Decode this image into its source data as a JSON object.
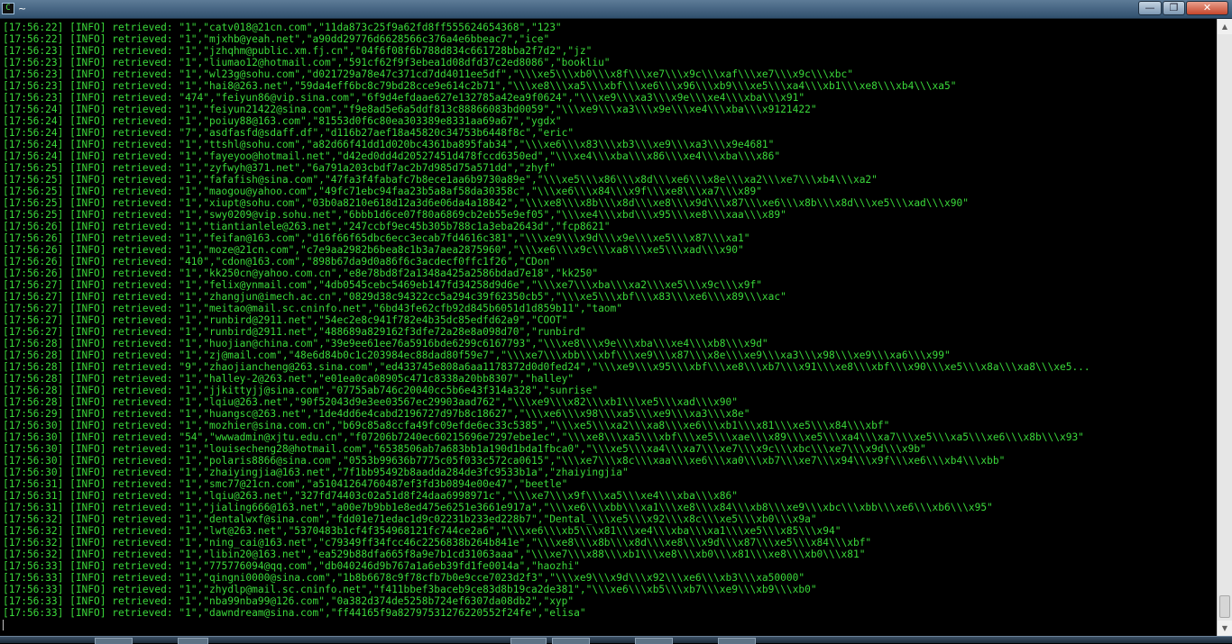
{
  "window": {
    "title": "~",
    "icon": "terminal-icon",
    "icon_glyph": "C",
    "minimize_glyph": "—",
    "maximize_glyph": "❐",
    "close_glyph": "✕"
  },
  "console": {
    "lines": [
      "[17:56:22] [INFO] retrieved: \"1\",\"catv018@21cn.com\",\"11da873c25f9a62fd8ff555624654368\",\"123\"",
      "[17:56:22] [INFO] retrieved: \"1\",\"mjxhb@yeah.net\",\"a90dd29776d6628566c376a4e6bbeac7\",\"ice\"",
      "[17:56:23] [INFO] retrieved: \"1\",\"jzhqhm@public.xm.fj.cn\",\"04f6f08f6b788d834c661728bba2f7d2\",\"jz\"",
      "[17:56:23] [INFO] retrieved: \"1\",\"liumao12@hotmail.com\",\"591cf62f9f3ebea1d08dfd37c2ed8086\",\"bookliu\"",
      "[17:56:23] [INFO] retrieved: \"1\",\"wl23g@sohu.com\",\"d021729a78e47c371cd7dd4011ee5df\",\"\\\\\\xe5\\\\\\xb0\\\\\\x8f\\\\\\xe7\\\\\\x9c\\\\\\xaf\\\\\\xe7\\\\\\x9c\\\\\\xbc\"",
      "[17:56:23] [INFO] retrieved: \"1\",\"hai8@263.net\",\"59da4eff6bc8c79bd28cce9e614c2b71\",\"\\\\\\xe8\\\\\\xa5\\\\\\xbf\\\\\\xe6\\\\\\x96\\\\\\xb9\\\\\\xe5\\\\\\xa4\\\\\\xb1\\\\\\xe8\\\\\\xb4\\\\\\xa5\"",
      "[17:56:23] [INFO] retrieved: \"474\",\"feiyun86@vip.sina.com\",\"6f9d4efdaae627e132785a42ea9f0624\",\"\\\\\\xe9\\\\\\xa3\\\\\\x9e\\\\\\xe4\\\\\\xba\\\\\\x91\"",
      "[17:56:24] [INFO] retrieved: \"1\",\"feiyun21422@sina.com\",\"f9e8ad5e6a5ddf813c88866083bd0059\",\"\\\\\\xe9\\\\\\xa3\\\\\\x9e\\\\\\xe4\\\\\\xba\\\\\\x9121422\"",
      "[17:56:24] [INFO] retrieved: \"1\",\"poiuy88@163.com\",\"81553d0f6c80ea303389e8331aa69a67\",\"ygdx\"",
      "[17:56:24] [INFO] retrieved: \"7\",\"asdfasfd@sdaff.df\",\"d116b27aef18a45820c34753b6448f8c\",\"eric\"",
      "[17:56:24] [INFO] retrieved: \"1\",\"ttshl@sohu.com\",\"a82d66f41dd1d020bc4361ba895fab34\",\"\\\\\\xe6\\\\\\x83\\\\\\xb3\\\\\\xe9\\\\\\xa3\\\\\\x9e4681\"",
      "[17:56:24] [INFO] retrieved: \"1\",\"fayeyoo@hotmail.net\",\"d42ed0dd4d20527451d478fccd6350ed\",\"\\\\\\xe4\\\\\\xba\\\\\\x86\\\\\\xe4\\\\\\xba\\\\\\x86\"",
      "[17:56:25] [INFO] retrieved: \"1\",\"zyfwyh@371.net\",\"6a791a203cbdf7ac2b7d985d75a571dd\",\"zhyf\"",
      "[17:56:25] [INFO] retrieved: \"1\",\"fafafish@sina.com\",\"47fa3f4fabafc7b8ece1aa6b9730a89e\",\"\\\\\\xe5\\\\\\x86\\\\\\x8d\\\\\\xe6\\\\\\x8e\\\\\\xa2\\\\\\xe7\\\\\\xb4\\\\\\xa2\"",
      "[17:56:25] [INFO] retrieved: \"1\",\"maogou@yahoo.com\",\"49fc71ebc94faa23b5a8af58da30358c\",\"\\\\\\xe6\\\\\\x84\\\\\\x9f\\\\\\xe8\\\\\\xa7\\\\\\x89\"",
      "[17:56:25] [INFO] retrieved: \"1\",\"xiupt@sohu.com\",\"03b0a8210e618d12a3d6e06da4a18842\",\"\\\\\\xe8\\\\\\x8b\\\\\\x8d\\\\\\xe8\\\\\\x9d\\\\\\x87\\\\\\xe6\\\\\\x8b\\\\\\x8d\\\\\\xe5\\\\\\xad\\\\\\x90\"",
      "[17:56:25] [INFO] retrieved: \"1\",\"swy0209@vip.sohu.net\",\"6bbb1d6ce07f80a6869cb2eb55e9ef05\",\"\\\\\\xe4\\\\\\xbd\\\\\\x95\\\\\\xe8\\\\\\xaa\\\\\\x89\"",
      "[17:56:26] [INFO] retrieved: \"1\",\"tiantianlele@263.net\",\"247ccbf9ec45b305b788c1a3eba2643d\",\"fcp8621\"",
      "[17:56:26] [INFO] retrieved: \"1\",\"feifan@163.com\",\"d16f66f65dbc6ecc3ecab7fd4616c381\",\"\\\\\\xe9\\\\\\x9d\\\\\\x9e\\\\\\xe5\\\\\\x87\\\\\\xa1\"",
      "[17:56:26] [INFO] retrieved: \"1\",\"moze@21cn.com\",\"c7e9aa2982b6bea8c1b3a7aea2875960\",\"\\\\\\xe6\\\\\\x9c\\\\\\xa8\\\\\\xe5\\\\\\xad\\\\\\x90\"",
      "[17:56:26] [INFO] retrieved: \"410\",\"cdon@163.com\",\"898b67da9d0a86f6c3acdecf0ffc1f26\",\"CDon\"",
      "[17:56:26] [INFO] retrieved: \"1\",\"kk250cn@yahoo.com.cn\",\"e8e78bd8f2a1348a425a2586bdad7e18\",\"kk250\"",
      "[17:56:27] [INFO] retrieved: \"1\",\"felix@ynmail.com\",\"4db0545cebc5469eb147fd34258d9d6e\",\"\\\\\\xe7\\\\\\xba\\\\\\xa2\\\\\\xe5\\\\\\x9c\\\\\\x9f\"",
      "[17:56:27] [INFO] retrieved: \"1\",\"zhangjun@imech.ac.cn\",\"0829d38c94322cc5a294c39f62350cb5\",\"\\\\\\xe5\\\\\\xbf\\\\\\x83\\\\\\xe6\\\\\\x89\\\\\\xac\"",
      "[17:56:27] [INFO] retrieved: \"1\",\"meitao@mail.sc.cninfo.net\",\"6bd43fe62cfb92d845b6051d1d859b11\",\"taom\"",
      "[17:56:27] [INFO] retrieved: \"1\",\"runbird@2911.net\",\"54ec2e8c941f782e4b35dc85edfd62a9\",\"COOT\"",
      "[17:56:27] [INFO] retrieved: \"1\",\"runbird@2911.net\",\"488689a829162f3dfe72a28e8a098d70\",\"runbird\"",
      "[17:56:28] [INFO] retrieved: \"1\",\"huojian@china.com\",\"39e9ee61ee76a5916bde6299c6167793\",\"\\\\\\xe8\\\\\\x9e\\\\\\xba\\\\\\xe4\\\\\\xb8\\\\\\x9d\"",
      "[17:56:28] [INFO] retrieved: \"1\",\"zj@mail.com\",\"48e6d84b0c1c203984ec88dad80f59e7\",\"\\\\\\xe7\\\\\\xbb\\\\\\xbf\\\\\\xe9\\\\\\x87\\\\\\x8e\\\\\\xe9\\\\\\xa3\\\\\\x98\\\\\\xe9\\\\\\xa6\\\\\\x99\"",
      "[17:56:28] [INFO] retrieved: \"9\",\"zhaojiancheng@263.sina.com\",\"ed433745e808a6aa1178372d0d0fed24\",\"\\\\\\xe9\\\\\\x95\\\\\\xbf\\\\\\xe8\\\\\\xb7\\\\\\x91\\\\\\xe8\\\\\\xbf\\\\\\x90\\\\\\xe5\\\\\\x8a\\\\\\xa8\\\\\\xe5...",
      "[17:56:28] [INFO] retrieved: \"1\",\"halley-2@263.net\",\"e01ea0ca08905c471c8338a20bb8307\",\"halley\"",
      "[17:56:28] [INFO] retrieved: \"1\",\"jjkittyjj@sina.com\",\"07755ab746c20040cc5b6e43f314a328\",\"sunrise\"",
      "[17:56:28] [INFO] retrieved: \"1\",\"lqiu@263.net\",\"90f52043d9e3ee03567ec29903aad762\",\"\\\\\\xe9\\\\\\x82\\\\\\xb1\\\\\\xe5\\\\\\xad\\\\\\x90\"",
      "[17:56:29] [INFO] retrieved: \"1\",\"huangsc@263.net\",\"1de4dd6e4cabd2196727d97b8c18627\",\"\\\\\\xe6\\\\\\x98\\\\\\xa5\\\\\\xe9\\\\\\xa3\\\\\\x8e\"",
      "[17:56:30] [INFO] retrieved: \"1\",\"mozhier@sina.com.cn\",\"b69c85a8ccfa49fc09efde6ec33c5385\",\"\\\\\\xe5\\\\\\xa2\\\\\\xa8\\\\\\xe6\\\\\\xb1\\\\\\x81\\\\\\xe5\\\\\\x84\\\\\\xbf\"",
      "[17:56:30] [INFO] retrieved: \"54\",\"wwwadmin@xjtu.edu.cn\",\"f07206b7240ec60215696e7297ebe1ec\",\"\\\\\\xe8\\\\\\xa5\\\\\\xbf\\\\\\xe5\\\\\\xae\\\\\\x89\\\\\\xe5\\\\\\xa4\\\\\\xa7\\\\\\xe5\\\\\\xa5\\\\\\xe6\\\\\\x8b\\\\\\x93\"",
      "[17:56:30] [INFO] retrieved: \"1\",\"louisecheng28@hotmail.com\",\"6538506ab7a683bb1a190d1bda1fbca0\",\"\\\\\\xe5\\\\\\xa4\\\\\\xa7\\\\\\xe7\\\\\\x9c\\\\\\xbc\\\\\\xe7\\\\\\x9d\\\\\\x9b\"",
      "[17:56:30] [INFO] retrieved: \"1\",\"polaris8866@sina.com\",\"0553b99636b7775c05f033c572ca0615\",\"\\\\\\xe7\\\\\\x8c\\\\\\xaa\\\\\\xe6\\\\\\xa0\\\\\\xb7\\\\\\xe7\\\\\\x94\\\\\\x9f\\\\\\xe6\\\\\\xb4\\\\\\xbb\"",
      "[17:56:30] [INFO] retrieved: \"1\",\"zhaiyingjia@163.net\",\"7f1bb95492b8aadda284de3fc9533b1a\",\"zhaiyingjia\"",
      "[17:56:31] [INFO] retrieved: \"1\",\"smc77@21cn.com\",\"a51041264760487ef3fd3b0894e00e47\",\"beetle\"",
      "[17:56:31] [INFO] retrieved: \"1\",\"lqiu@263.net\",\"327fd74403c02a51d8f24daa6998971c\",\"\\\\\\xe7\\\\\\x9f\\\\\\xa5\\\\\\xe4\\\\\\xba\\\\\\x86\"",
      "[17:56:31] [INFO] retrieved: \"1\",\"jialing666@163.net\",\"a00e7b9bb1e8ed475e6251e3661e917a\",\"\\\\\\xe6\\\\\\xbb\\\\\\xa1\\\\\\xe8\\\\\\x84\\\\\\xb8\\\\\\xe9\\\\\\xbc\\\\\\xbb\\\\\\xe6\\\\\\xb6\\\\\\x95\"",
      "[17:56:32] [INFO] retrieved: \"1\",\"dentalwxf@sina.com\",\"fdd01e71edac1d9c02231b233ed228b7\",\"Dental_\\\\\\xe5\\\\\\x92\\\\\\x8c\\\\\\xe5\\\\\\xb0\\\\\\x9a\"",
      "[17:56:32] [INFO] retrieved: \"1\",\"lwt@263.net\",\"5370483b1cf4f354968121fc744ce2a6\",\"\\\\\\xe6\\\\\\xb5\\\\\\x81\\\\\\xe4\\\\\\xba\\\\\\xa1\\\\\\xe5\\\\\\x85\\\\\\x94\"",
      "[17:56:32] [INFO] retrieved: \"1\",\"ning_cai@163.net\",\"c79349ff34fcc46c2256838b264b841e\",\"\\\\\\xe8\\\\\\x8b\\\\\\x8d\\\\\\xe8\\\\\\x9d\\\\\\x87\\\\\\xe5\\\\\\x84\\\\\\xbf\"",
      "[17:56:32] [INFO] retrieved: \"1\",\"libin20@163.net\",\"ea529b88dfa665f8a9e7b1cd31063aaa\",\"\\\\\\xe7\\\\\\x88\\\\\\xb1\\\\\\xe8\\\\\\xb0\\\\\\x81\\\\\\xe8\\\\\\xb0\\\\\\x81\"",
      "[17:56:33] [INFO] retrieved: \"1\",\"775776094@qq.com\",\"db040246d9b767a1a6eb39fd1fe0014a\",\"haozhi\"",
      "[17:56:33] [INFO] retrieved: \"1\",\"qingni0000@sina.com\",\"1b8b6678c9f78cfb7b0e9cce7023d2f3\",\"\\\\\\xe9\\\\\\x9d\\\\\\x92\\\\\\xe6\\\\\\xb3\\\\\\xa50000\"",
      "[17:56:33] [INFO] retrieved: \"1\",\"zhydlp@mail.sc.cninfo.net\",\"f411bbef3baceb9ce83d8b19ca2de381\",\"\\\\\\xe6\\\\\\xb5\\\\\\xb7\\\\\\xe9\\\\\\xb9\\\\\\xb0\"",
      "[17:56:33] [INFO] retrieved: \"1\",\"nba99nba99@126.com\",\"0a382d374de5258b724ef6307da08db2\",\"xyp\"",
      "[17:56:33] [INFO] retrieved: \"1\",\"dawndream@sina.com\",\"ff44165f9a82797531276220552f24fe\",\"elisa\""
    ]
  },
  "scrollbar": {
    "up_arrow": "▲",
    "down_arrow": "▼"
  },
  "colors": {
    "console_text": "#3ad93a",
    "console_background": "#000000"
  }
}
